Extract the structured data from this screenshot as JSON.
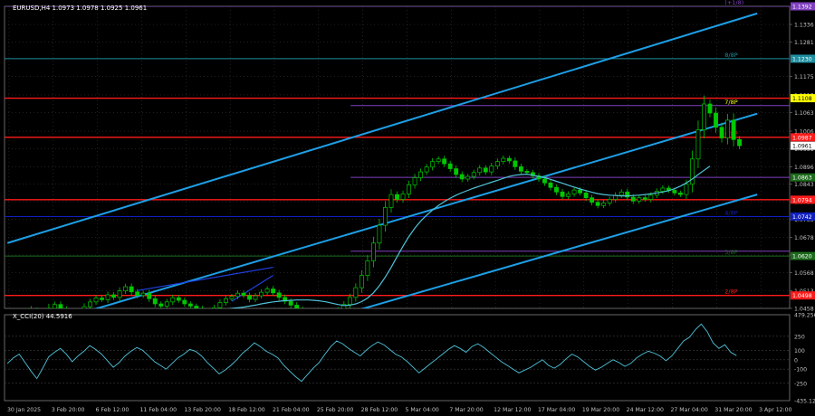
{
  "header": {
    "symbol_info": "EURUSD,H4  1.0973 1.0978 1.0925 1.0961",
    "indicator_info": "X_CCI(20) 44.5916"
  },
  "colors": {
    "background": "#000000",
    "bull": "#00c800",
    "bear": "#00c800",
    "ma": "#4fc3d9",
    "channel": "#1e9fe6",
    "grid": "#404040",
    "axis_text": "#c0c0c0",
    "red": "#ff1a1a",
    "purple": "#8040c0",
    "teal": "#1e8fa0",
    "navy": "#1020c0"
  },
  "chart_data": [
    {
      "type": "candlestick",
      "symbol": "EURUSD",
      "timeframe": "H4",
      "ohlc_last": {
        "open": 1.0973,
        "high": 1.0978,
        "low": 1.0925,
        "close": 1.0961
      },
      "ylim": [
        1.0458,
        1.1392
      ],
      "x_tick_labels": [
        "30 Jan 2025",
        "3 Feb 20:00",
        "6 Feb 12:00",
        "11 Feb 04:00",
        "13 Feb 20:00",
        "18 Feb 12:00",
        "21 Feb 04:00",
        "25 Feb 20:00",
        "28 Feb 12:00",
        "5 Mar 04:00",
        "7 Mar 20:00",
        "12 Mar 12:00",
        "17 Mar 04:00",
        "19 Mar 20:00",
        "24 Mar 12:00",
        "27 Mar 04:00",
        "31 Mar 20:00",
        "3 Apr 12:00"
      ],
      "y_tick_labels": [
        "1.1336",
        "1.1281",
        "1.1175",
        "1.1118",
        "1.1063",
        "1.1006",
        "1.0951",
        "1.0896",
        "1.0843",
        "1.0788",
        "1.0733",
        "1.0678",
        "1.0623",
        "1.0568",
        "1.0513",
        "1.0458"
      ],
      "price_tags": [
        {
          "value": 1.1392,
          "text": "1.1392",
          "color": "#8040c0"
        },
        {
          "value": 1.123,
          "text": "1.1230",
          "color": "#1e8fa0"
        },
        {
          "value": 1.1108,
          "text": "1.1108",
          "color": "#ffff00"
        },
        {
          "value": 1.0987,
          "text": "1.0987",
          "color": "#ff1a1a"
        },
        {
          "value": 1.0961,
          "text": "1.0961",
          "color": "#ffffff"
        },
        {
          "value": 1.0863,
          "text": "1.0863",
          "color": "#1c6b1c"
        },
        {
          "value": 1.0794,
          "text": "1.0794",
          "color": "#ff1a1a"
        },
        {
          "value": 1.0742,
          "text": "1.0742",
          "color": "#1020c0"
        },
        {
          "value": 1.062,
          "text": "1.0620",
          "color": "#1c6b1c"
        },
        {
          "value": 1.0498,
          "text": "1.0498",
          "color": "#ff1a1a"
        }
      ],
      "horizontal_levels": [
        {
          "value": 1.1392,
          "color": "#8040c0",
          "from": "start",
          "label": "(+1/8)",
          "label_color": "#8040c0"
        },
        {
          "value": 1.123,
          "color": "#1e8fa0",
          "from": "start",
          "label": "8/8P",
          "label_color": "#1e8fa0"
        },
        {
          "value": 1.1108,
          "color": "#ff1a1a",
          "from": "start",
          "label": "",
          "label_color": ""
        },
        {
          "value": 1.1085,
          "color": "#8040c0",
          "from": "mid",
          "label": "7/8P",
          "label_color": "#ffff00"
        },
        {
          "value": 1.0987,
          "color": "#ff1a1a",
          "from": "start",
          "label": "6/8P",
          "label_color": "#ff1a1a"
        },
        {
          "value": 1.0863,
          "color": "#8040c0",
          "from": "mid",
          "label": "",
          "label_color": ""
        },
        {
          "value": 1.0794,
          "color": "#ff1a1a",
          "from": "start",
          "label": "",
          "label_color": ""
        },
        {
          "value": 1.0742,
          "color": "#1020c0",
          "from": "start",
          "label": "4/8P",
          "label_color": "#1020c0"
        },
        {
          "value": 1.0635,
          "color": "#8040c0",
          "from": "mid",
          "label": "",
          "label_color": ""
        },
        {
          "value": 1.062,
          "color": "#1c6b1c",
          "from": "start",
          "label": "3/8P",
          "label_color": "#1c6b1c"
        },
        {
          "value": 1.0498,
          "color": "#ff1a1a",
          "from": "start",
          "label": "2/8P",
          "label_color": "#ff1a1a"
        }
      ],
      "close_series": [
        1.0395,
        1.0415,
        1.0432,
        1.0418,
        1.0451,
        1.0436,
        1.0425,
        1.0458,
        1.047,
        1.0455,
        1.044,
        1.0428,
        1.0445,
        1.0463,
        1.0478,
        1.049,
        1.0485,
        1.05,
        1.0492,
        1.0512,
        1.0525,
        1.0509,
        1.0498,
        1.0505,
        1.0488,
        1.0472,
        1.0465,
        1.0478,
        1.0491,
        1.0483,
        1.0472,
        1.0465,
        1.0458,
        1.045,
        1.0447,
        1.046,
        1.0476,
        1.0488,
        1.0495,
        1.0505,
        1.0498,
        1.0486,
        1.0497,
        1.0508,
        1.0518,
        1.0506,
        1.0492,
        1.048,
        1.0468,
        1.0455,
        1.0445,
        1.0432,
        1.0428,
        1.042,
        1.0425,
        1.0438,
        1.0452,
        1.047,
        1.0492,
        1.0522,
        1.056,
        1.0605,
        1.066,
        1.0715,
        1.077,
        1.081,
        1.0795,
        1.0812,
        1.084,
        1.0862,
        1.088,
        1.0895,
        1.0912,
        1.092,
        1.0905,
        1.089,
        1.0872,
        1.0858,
        1.0866,
        1.0878,
        1.0892,
        1.088,
        1.0898,
        1.0912,
        1.0922,
        1.0914,
        1.0896,
        1.0882,
        1.0878,
        1.0868,
        1.0858,
        1.0846,
        1.0832,
        1.0818,
        1.0804,
        1.0812,
        1.0824,
        1.0815,
        1.08,
        1.0786,
        1.0776,
        1.0784,
        1.0795,
        1.0808,
        1.0818,
        1.0802,
        1.079,
        1.08,
        1.0795,
        1.0808,
        1.082,
        1.083,
        1.0823,
        1.0815,
        1.081,
        1.0842,
        1.092,
        1.101,
        1.109,
        1.1062,
        1.1018,
        1.0985,
        1.104,
        1.098,
        1.0961
      ],
      "ma_values": [
        1.0418,
        1.0424,
        1.043,
        1.0436,
        1.0442,
        1.0447,
        1.0451,
        1.0455,
        1.0458,
        1.046,
        1.0462,
        1.0465,
        1.0468,
        1.0472,
        1.0475,
        1.0478,
        1.048,
        1.0482,
        1.0483,
        1.0484,
        1.0484,
        1.0484,
        1.0483,
        1.0481,
        1.0478,
        1.0474,
        1.047,
        1.0467,
        1.0468,
        1.0472,
        1.0479,
        1.049,
        1.0506,
        1.0528,
        1.0555,
        1.0585,
        1.0618,
        1.065,
        1.068,
        1.0706,
        1.0728,
        1.0746,
        1.0762,
        1.0776,
        1.0788,
        1.0799,
        1.0808,
        1.0816,
        1.0823,
        1.083,
        1.0836,
        1.0842,
        1.0848,
        1.0854,
        1.086,
        1.0866,
        1.087,
        1.0872,
        1.0873,
        1.087,
        1.0866,
        1.0862,
        1.0857,
        1.0851,
        1.0845,
        1.0839,
        1.0833,
        1.0827,
        1.0822,
        1.0817,
        1.0813,
        1.081,
        1.0808,
        1.0807,
        1.0806,
        1.0806,
        1.0807,
        1.0808,
        1.081,
        1.0812,
        1.0815,
        1.0818,
        1.0822,
        1.0828,
        1.0836,
        1.0846,
        1.0858,
        1.0872,
        1.0885,
        1.0898
      ],
      "ma_start_index": 30,
      "channel_lines": [
        {
          "from": [
            0,
            1.066
          ],
          "to": [
            127,
            1.137
          ],
          "color": "#1e9fe6"
        },
        {
          "from": [
            10,
            1.043
          ],
          "to": [
            127,
            1.106
          ],
          "color": "#1e9fe6"
        },
        {
          "from": [
            57,
            1.044
          ],
          "to": [
            127,
            1.081
          ],
          "color": "#1e9fe6"
        }
      ],
      "short_lines": [
        {
          "from": [
            22,
            1.0513
          ],
          "to": [
            45,
            1.0585
          ],
          "color": "#2040e0"
        },
        {
          "from": [
            38,
            1.048
          ],
          "to": [
            45,
            1.056
          ],
          "color": "#2040e0"
        }
      ]
    },
    {
      "type": "line",
      "name": "X_CCI(20)",
      "current_value": 44.5916,
      "ylim": [
        -435.125,
        479.2565
      ],
      "y_tick_labels": [
        "479.2565",
        "250",
        "100",
        "0",
        "-100",
        "-250",
        "-435.125"
      ],
      "levels": [
        250,
        100,
        0,
        -100,
        -250
      ],
      "values": [
        -40,
        20,
        60,
        -30,
        -120,
        -200,
        -90,
        30,
        80,
        120,
        60,
        -20,
        40,
        90,
        150,
        110,
        60,
        -10,
        -80,
        -30,
        40,
        90,
        130,
        100,
        40,
        -20,
        -60,
        -100,
        -40,
        20,
        60,
        110,
        90,
        40,
        -30,
        -90,
        -150,
        -110,
        -60,
        0,
        70,
        120,
        180,
        140,
        90,
        60,
        20,
        -60,
        -120,
        -180,
        -230,
        -160,
        -90,
        -30,
        60,
        140,
        200,
        170,
        120,
        80,
        40,
        100,
        150,
        190,
        160,
        110,
        60,
        30,
        -20,
        -80,
        -140,
        -90,
        -40,
        10,
        60,
        110,
        150,
        120,
        80,
        140,
        170,
        130,
        80,
        30,
        -20,
        -60,
        -100,
        -140,
        -110,
        -80,
        -40,
        0,
        -60,
        -90,
        -50,
        10,
        60,
        30,
        -20,
        -70,
        -110,
        -80,
        -40,
        0,
        -30,
        -70,
        -40,
        20,
        60,
        90,
        70,
        40,
        -10,
        40,
        120,
        200,
        240,
        320,
        380,
        300,
        180,
        120,
        160,
        80,
        44.5916
      ],
      "line_color": "#4fc3d9"
    }
  ]
}
